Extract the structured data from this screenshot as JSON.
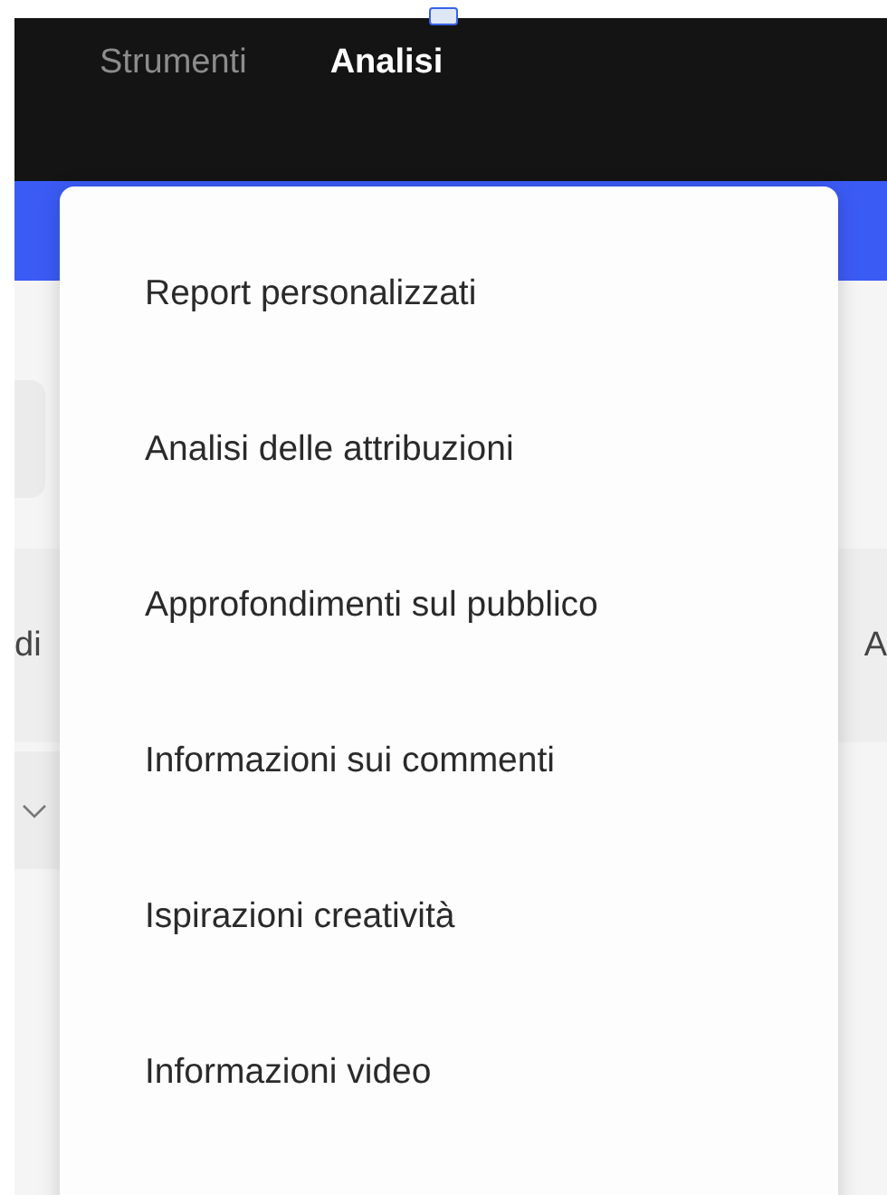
{
  "nav_tabs": [
    {
      "label": "Strumenti",
      "selected": false
    },
    {
      "label": "Analisi",
      "selected": true
    }
  ],
  "background": {
    "column_header_left": "di",
    "column_header_right": "A"
  },
  "menu": {
    "items": [
      {
        "label": "Report personalizzati"
      },
      {
        "label": "Analisi delle attribuzioni"
      },
      {
        "label": "Approfondimenti sul pubblico"
      },
      {
        "label": "Informazioni sui commenti"
      },
      {
        "label": "Ispirazioni creatività"
      },
      {
        "label": "Informazioni video"
      }
    ]
  }
}
